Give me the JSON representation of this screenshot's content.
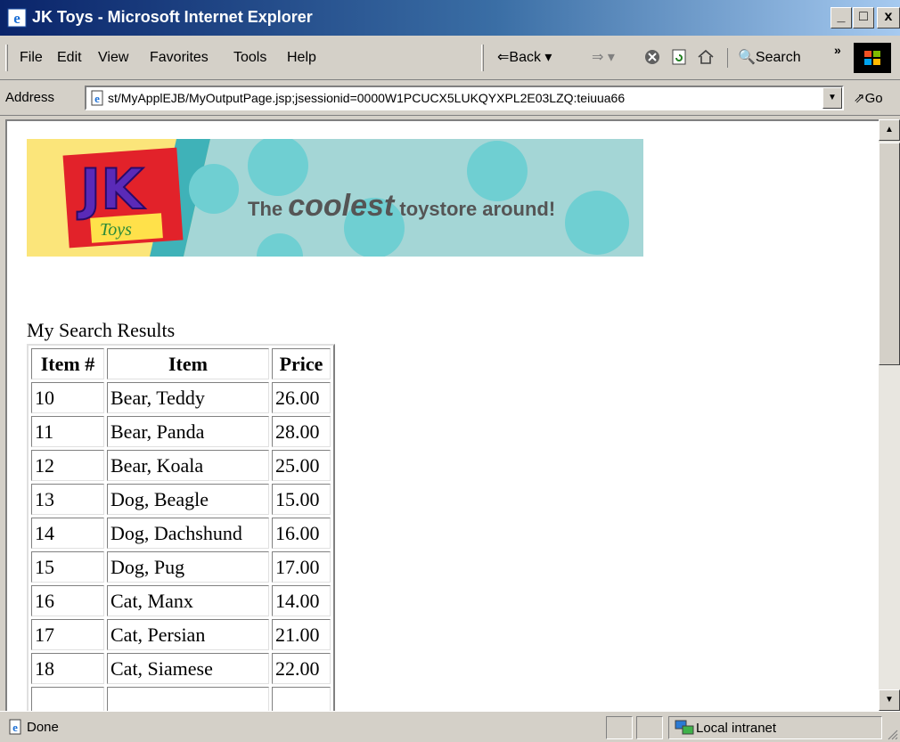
{
  "window": {
    "title": "JK Toys - Microsoft Internet Explorer",
    "minimize": "_",
    "maximize": "□",
    "close": "x"
  },
  "menu": {
    "items": [
      "File",
      "Edit",
      "View",
      "Favorites",
      "Tools",
      "Help"
    ]
  },
  "toolbar": {
    "back_label": "Back",
    "search_label": "Search",
    "chevron": "»"
  },
  "address": {
    "label": "Address",
    "url": "st/MyApplEJB/MyOutputPage.jsp;jsessionid=0000W1PCUCX5LUKQYXPL2E03LZQ:teiuua66",
    "go_label": "Go"
  },
  "banner": {
    "logo_text": "JK",
    "logo_sub": "Toys",
    "tagline_pre": "The ",
    "tagline_em": "coolest",
    "tagline_post": " toystore around!"
  },
  "results": {
    "title": "My Search Results",
    "columns": [
      "Item #",
      "Item",
      "Price"
    ],
    "rows": [
      [
        "10",
        "Bear, Teddy",
        "26.00"
      ],
      [
        "11",
        "Bear, Panda",
        "28.00"
      ],
      [
        "12",
        "Bear, Koala",
        "25.00"
      ],
      [
        "13",
        "Dog, Beagle",
        "15.00"
      ],
      [
        "14",
        "Dog, Dachshund",
        "16.00"
      ],
      [
        "15",
        "Dog, Pug",
        "17.00"
      ],
      [
        "16",
        "Cat, Manx",
        "14.00"
      ],
      [
        "17",
        "Cat, Persian",
        "21.00"
      ],
      [
        "18",
        "Cat, Siamese",
        "22.00"
      ],
      [
        "",
        "",
        ""
      ]
    ]
  },
  "status": {
    "text": "Done",
    "zone": "Local intranet"
  },
  "icons": {
    "app": "ie-icon",
    "back": "back-arrow-icon",
    "forward": "forward-arrow-icon",
    "stop": "stop-icon",
    "refresh": "refresh-icon",
    "home": "home-icon",
    "search": "search-icon",
    "page": "page-icon",
    "go": "go-arrow-icon",
    "zone": "intranet-icon"
  }
}
